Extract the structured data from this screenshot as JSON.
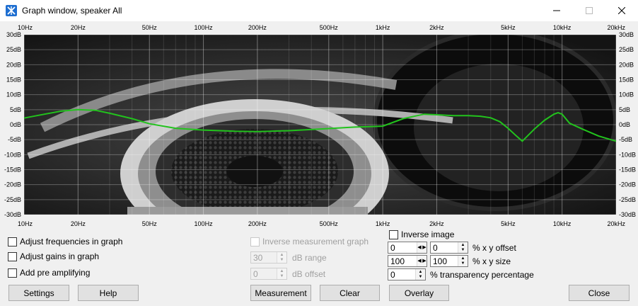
{
  "window": {
    "title": "Graph window, speaker All"
  },
  "chart_data": {
    "type": "line",
    "x_scale": "log",
    "xlim": [
      10,
      20000
    ],
    "ylim": [
      -30,
      30
    ],
    "grid": true,
    "x_ticks": [
      "10Hz",
      "20Hz",
      "50Hz",
      "100Hz",
      "200Hz",
      "500Hz",
      "1kHz",
      "2kHz",
      "5kHz",
      "10kHz",
      "20kHz"
    ],
    "x_tick_values": [
      10,
      20,
      50,
      100,
      200,
      500,
      1000,
      2000,
      5000,
      10000,
      20000
    ],
    "y_ticks": [
      "30dB",
      "25dB",
      "20dB",
      "15dB",
      "10dB",
      "5dB",
      "0dB",
      "-5dB",
      "-10dB",
      "-15dB",
      "-20dB",
      "-25dB",
      "-30dB"
    ],
    "y_tick_values": [
      30,
      25,
      20,
      15,
      10,
      5,
      0,
      -5,
      -10,
      -15,
      -20,
      -25,
      -30
    ],
    "series": [
      {
        "color": "#22c31d",
        "x": [
          10,
          13,
          16,
          20,
          25,
          30,
          40,
          50,
          70,
          100,
          150,
          200,
          300,
          500,
          700,
          1000,
          1300,
          1700,
          2000,
          2500,
          3000,
          3500,
          4000,
          4500,
          5000,
          5500,
          6000,
          7000,
          8000,
          9000,
          9500,
          10000,
          11000,
          13000,
          16000,
          20000
        ],
        "y": [
          2.2,
          3.5,
          4.5,
          5.0,
          4.8,
          3.8,
          2.0,
          0.3,
          -1.2,
          -1.8,
          -2.2,
          -2.3,
          -2.0,
          -1.3,
          -0.8,
          -0.5,
          2.0,
          3.5,
          3.3,
          3.0,
          3.0,
          2.8,
          2.3,
          1.0,
          -1.2,
          -3.5,
          -5.5,
          -1.5,
          1.5,
          3.5,
          4.0,
          3.5,
          0.5,
          -1.5,
          -3.8,
          -5.5
        ]
      }
    ],
    "background_image": "headphones-photo"
  },
  "controls": {
    "adjust_frequencies": "Adjust frequencies in graph",
    "adjust_gains": "Adjust gains in graph",
    "add_pre_amplifying": "Add pre amplifying",
    "inverse_measurement": "Inverse measurement graph",
    "db_range_value": "30",
    "db_range_label": "dB range",
    "db_offset_value": "0",
    "db_offset_label": "dB offset",
    "inverse_image": "Inverse image",
    "offset_x": "0",
    "offset_y": "0",
    "offset_label": "% x y offset",
    "size_x": "100",
    "size_y": "100",
    "size_label": "% x y size",
    "transparency_value": "0",
    "transparency_label": "% transparency percentage"
  },
  "buttons": {
    "settings": "Settings",
    "help": "Help",
    "measurement": "Measurement",
    "clear": "Clear",
    "overlay": "Overlay",
    "close": "Close"
  }
}
